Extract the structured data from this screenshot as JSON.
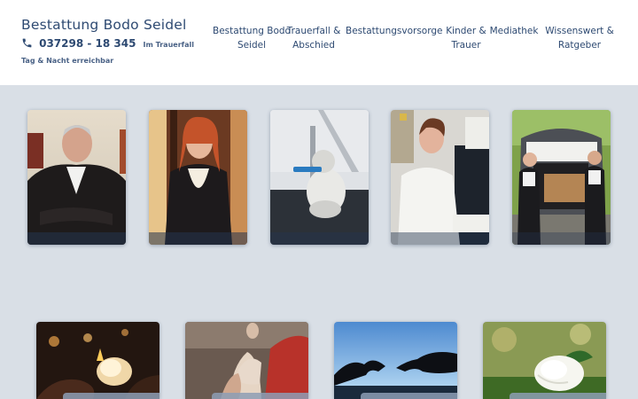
{
  "brand": {
    "name": "Bestattung Bodo Seidel",
    "phone": "037298 - 18 345",
    "phone_note": "Im Trauerfall Tag & Nacht erreichbar"
  },
  "nav": {
    "items": [
      {
        "label": "Bestattung Bodo\nSeidel"
      },
      {
        "label": "Trauerfall &\nAbschied"
      },
      {
        "label": "Bestattungsvorsorge"
      },
      {
        "label": "Kinder &\nTrauer"
      },
      {
        "label": "Mediathek"
      },
      {
        "label": "Wissenswert &\nRatgeber"
      }
    ]
  },
  "colors": {
    "brand": "#2e4a72",
    "page_background": "#d9dfe6",
    "header_background": "#ffffff"
  },
  "icons": {
    "phone": "phone-icon"
  }
}
